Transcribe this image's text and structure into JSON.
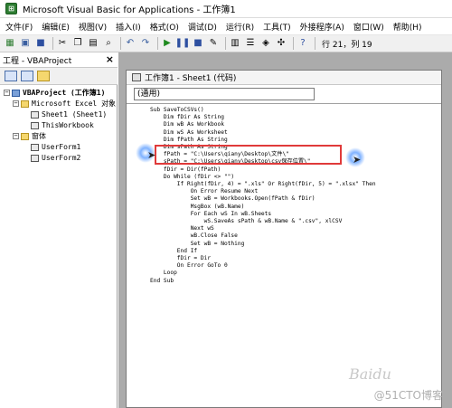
{
  "window": {
    "title": "Microsoft Visual Basic for Applications - 工作簿1",
    "icon": "vba-app-icon"
  },
  "menu": [
    {
      "label": "文件(F)"
    },
    {
      "label": "编辑(E)"
    },
    {
      "label": "视图(V)"
    },
    {
      "label": "插入(I)"
    },
    {
      "label": "格式(O)"
    },
    {
      "label": "调试(D)"
    },
    {
      "label": "运行(R)"
    },
    {
      "label": "工具(T)"
    },
    {
      "label": "外接程序(A)"
    },
    {
      "label": "窗口(W)"
    },
    {
      "label": "帮助(H)"
    }
  ],
  "toolbar": {
    "cursor_position": "行 21，列 19"
  },
  "project_panel": {
    "title": "工程 - VBAProject",
    "close": "×",
    "tree": [
      {
        "label": "VBAProject (工作簿1)",
        "toggle": "−",
        "bold": true
      },
      {
        "label": "Microsoft Excel 对象",
        "toggle": "−"
      },
      {
        "label": "Sheet1 (Sheet1)"
      },
      {
        "label": "ThisWorkbook"
      },
      {
        "label": "窗体",
        "toggle": "−"
      },
      {
        "label": "UserForm1"
      },
      {
        "label": "UserForm2"
      }
    ]
  },
  "code_window": {
    "title": "工作簿1 - Sheet1 (代码)",
    "combo_value": "(通用)",
    "lines": [
      "Sub SaveToCSVs()",
      "    Dim fDir As String",
      "    Dim wB As Workbook",
      "    Dim wS As Worksheet",
      "    Dim fPath As String",
      "    Dim sPath As String",
      "    fPath = \"C:\\Users\\qiany\\Desktop\\文件\\\"",
      "    sPath = \"C:\\Users\\qiany\\Desktop\\csv保存位置\\\"",
      "    fDir = Dir(fPath)",
      "    Do While (fDir <> \"\")",
      "        If Right(fDir, 4) = \".xls\" Or Right(fDir, 5) = \".xlsx\" Then",
      "            On Error Resume Next",
      "            Set wB = Workbooks.Open(fPath & fDir)",
      "            MsgBox (wB.Name)",
      "            For Each wS In wB.Sheets",
      "                wS.SaveAs sPath & wB.Name & \".csv\", xlCSV",
      "            Next wS",
      "            wB.Close False",
      "            Set wB = Nothing",
      "        End If",
      "        fDir = Dir",
      "        On Error GoTo 0",
      "    Loop",
      "End Sub"
    ]
  },
  "watermark": {
    "text": "@51CTO博客",
    "logo_text": "Baidu"
  },
  "colors": {
    "highlight_border": "#e03a3a",
    "keyword": "#00008b",
    "mdi_background": "#ababab"
  }
}
